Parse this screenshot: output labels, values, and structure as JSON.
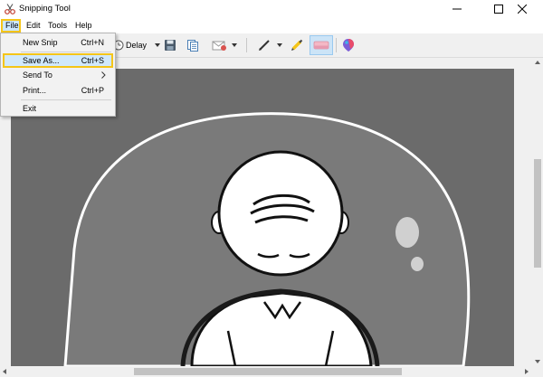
{
  "window": {
    "title": "Snipping Tool",
    "controls": {
      "minimize": "minimize",
      "maximize": "maximize",
      "close": "close"
    }
  },
  "menubar": {
    "items": [
      {
        "label": "File",
        "active": true
      },
      {
        "label": "Edit",
        "active": false
      },
      {
        "label": "Tools",
        "active": false
      },
      {
        "label": "Help",
        "active": false
      }
    ]
  },
  "toolbar": {
    "delay_label": "Delay",
    "buttons": [
      "delay",
      "save",
      "copy",
      "send",
      "pen",
      "highlighter",
      "eraser",
      "paint3d"
    ]
  },
  "file_menu": {
    "items": [
      {
        "label": "New Snip",
        "shortcut": "Ctrl+N"
      },
      {
        "label": "Save As...",
        "shortcut": "Ctrl+S",
        "highlighted": true
      },
      {
        "label": "Send To",
        "shortcut": "",
        "submenu": true
      },
      {
        "label": "Print...",
        "shortcut": "Ctrl+P"
      },
      {
        "label": "Exit",
        "shortcut": ""
      }
    ]
  },
  "colors": {
    "highlight_outline": "#f5c518",
    "menu_hover": "#cce8ff",
    "canvas_bg": "#6b6b6b"
  }
}
